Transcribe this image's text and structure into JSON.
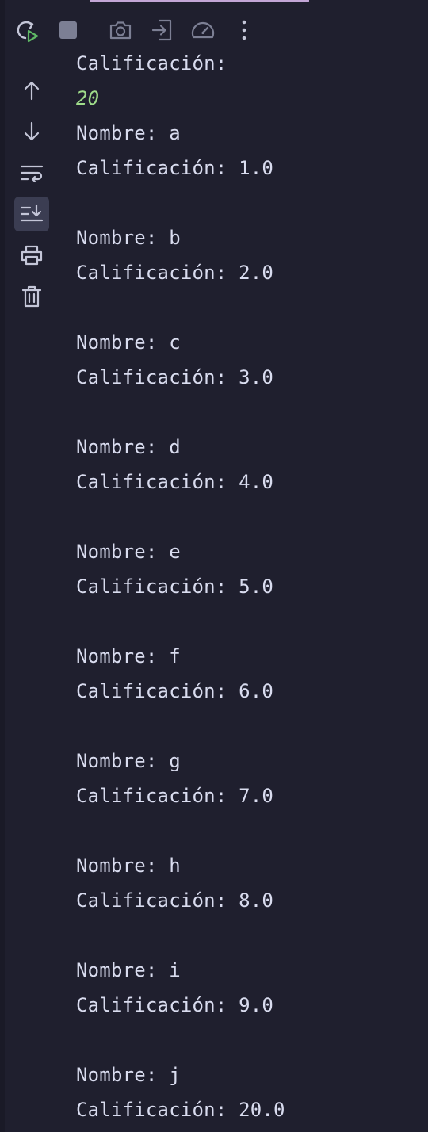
{
  "toolbar": {
    "buttons": [
      {
        "name": "rerun-icon",
        "label": "Rerun"
      },
      {
        "name": "stop-icon",
        "label": "Stop"
      },
      {
        "name": "camera-icon",
        "label": "Screenshot"
      },
      {
        "name": "login-icon",
        "label": "Attach"
      },
      {
        "name": "speedometer-icon",
        "label": "Profile"
      },
      {
        "name": "more-icon",
        "label": "More"
      }
    ]
  },
  "gutter": {
    "buttons": [
      {
        "name": "scroll-up-icon",
        "active": false
      },
      {
        "name": "scroll-down-icon",
        "active": false
      },
      {
        "name": "soft-wrap-icon",
        "active": false
      },
      {
        "name": "scroll-to-end-icon",
        "active": true
      },
      {
        "name": "print-icon",
        "active": false
      },
      {
        "name": "trash-icon",
        "active": false
      }
    ]
  },
  "console": {
    "partial_line": "Calificación:",
    "input_echo": "20",
    "records": [
      {
        "nombre": "Nombre: a",
        "calificacion": "Calificación: 1.0"
      },
      {
        "nombre": "Nombre: b",
        "calificacion": "Calificación: 2.0"
      },
      {
        "nombre": "Nombre: c",
        "calificacion": "Calificación: 3.0"
      },
      {
        "nombre": "Nombre: d",
        "calificacion": "Calificación: 4.0"
      },
      {
        "nombre": "Nombre: e",
        "calificacion": "Calificación: 5.0"
      },
      {
        "nombre": "Nombre: f",
        "calificacion": "Calificación: 6.0"
      },
      {
        "nombre": "Nombre: g",
        "calificacion": "Calificación: 7.0"
      },
      {
        "nombre": "Nombre: h",
        "calificacion": "Calificación: 8.0"
      },
      {
        "nombre": "Nombre: i",
        "calificacion": "Calificación: 9.0"
      },
      {
        "nombre": "Nombre: j",
        "calificacion": "Calificación: 20.0"
      }
    ]
  },
  "colors": {
    "background": "#1f1f2e",
    "text": "#d9dcef",
    "input_echo": "#9fdc8a",
    "icon": "#c4c6d8",
    "icon_dim": "#7c7f94",
    "accent_green": "#5fb865"
  }
}
